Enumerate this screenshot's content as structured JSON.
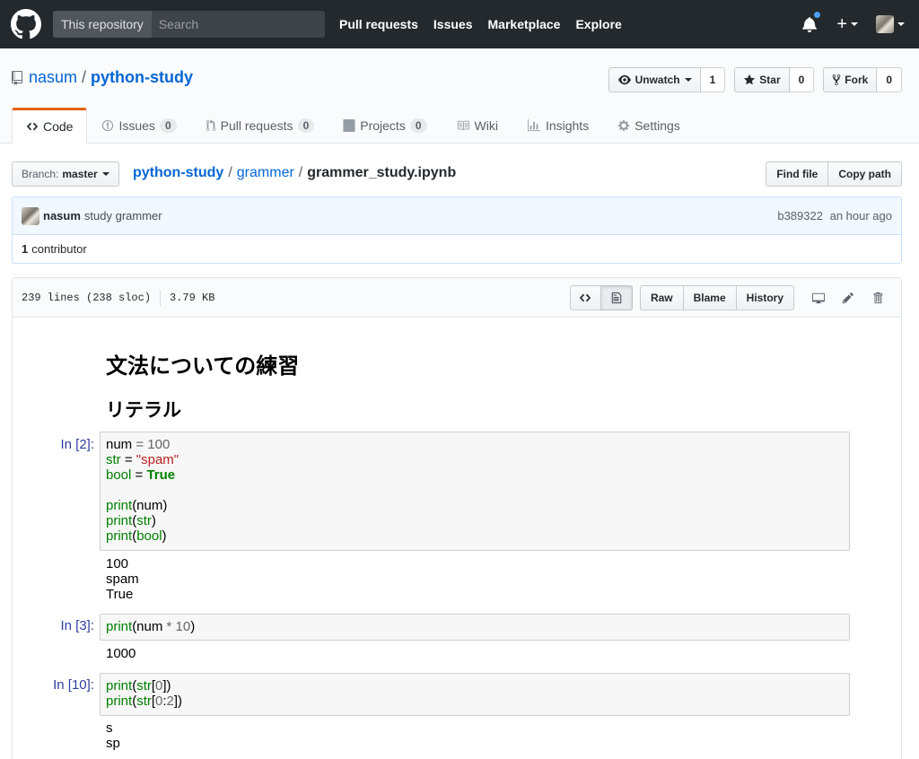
{
  "header": {
    "scope": "This repository",
    "search_placeholder": "Search",
    "nav": [
      "Pull requests",
      "Issues",
      "Marketplace",
      "Explore"
    ],
    "plus": "+"
  },
  "repo": {
    "owner": "nasum",
    "separator": "/",
    "name": "python-study",
    "watch_label": "Unwatch",
    "watch_count": "1",
    "star_label": "Star",
    "star_count": "0",
    "fork_label": "Fork",
    "fork_count": "0"
  },
  "tabs": [
    {
      "label": "Code",
      "icon": "code-icon"
    },
    {
      "label": "Issues",
      "count": "0",
      "icon": "issue-icon"
    },
    {
      "label": "Pull requests",
      "count": "0",
      "icon": "pull-request-icon"
    },
    {
      "label": "Projects",
      "count": "0",
      "icon": "project-icon"
    },
    {
      "label": "Wiki",
      "icon": "book-icon"
    },
    {
      "label": "Insights",
      "icon": "graph-icon"
    },
    {
      "label": "Settings",
      "icon": "gear-icon"
    }
  ],
  "file_nav": {
    "branch_label": "Branch:",
    "branch": "master",
    "crumbs": [
      "python-study",
      "grammer"
    ],
    "filename": "grammer_study.ipynb",
    "sep": "/",
    "find_file": "Find file",
    "copy_path": "Copy path"
  },
  "commit": {
    "author": "nasum",
    "message": "study grammer",
    "sha": "b389322",
    "time": "an hour ago",
    "contributors_count": "1",
    "contributors_label": "contributor"
  },
  "file": {
    "lines": "239 lines (238 sloc)",
    "size": "3.79 KB",
    "raw": "Raw",
    "blame": "Blame",
    "history": "History"
  },
  "notebook": {
    "h1": "文法についての練習",
    "h2": "リテラル",
    "cells": [
      {
        "prompt": "In [2]:",
        "code": [
          [
            [
              "num ",
              ""
            ],
            [
              "=",
              "n"
            ],
            [
              " ",
              ""
            ],
            [
              "100",
              "n"
            ]
          ],
          [
            [
              "str",
              "k"
            ],
            [
              " = ",
              ""
            ],
            [
              "\"spam\"",
              "s"
            ]
          ],
          [
            [
              "bool",
              "k"
            ],
            [
              " = ",
              ""
            ],
            [
              "True",
              "b"
            ]
          ],
          [],
          [
            [
              "print",
              "k"
            ],
            [
              "(num)",
              ""
            ]
          ],
          [
            [
              "print",
              "k"
            ],
            [
              "(",
              ""
            ],
            [
              "str",
              "k"
            ],
            [
              ")",
              ""
            ]
          ],
          [
            [
              "print",
              "k"
            ],
            [
              "(",
              ""
            ],
            [
              "bool",
              "k"
            ],
            [
              ")",
              ""
            ]
          ]
        ],
        "output": [
          "100",
          "spam",
          "True"
        ]
      },
      {
        "prompt": "In [3]:",
        "code": [
          [
            [
              "print",
              "k"
            ],
            [
              "(num ",
              ""
            ],
            [
              "*",
              "n"
            ],
            [
              " ",
              ""
            ],
            [
              "10",
              "n"
            ],
            [
              ")",
              ""
            ]
          ]
        ],
        "output": [
          "1000"
        ]
      },
      {
        "prompt": "In [10]:",
        "code": [
          [
            [
              "print",
              "k"
            ],
            [
              "(",
              ""
            ],
            [
              "str",
              "k"
            ],
            [
              "[",
              ""
            ],
            [
              "0",
              "n"
            ],
            [
              "])",
              ""
            ]
          ],
          [
            [
              "print",
              "k"
            ],
            [
              "(",
              ""
            ],
            [
              "str",
              "k"
            ],
            [
              "[",
              ""
            ],
            [
              "0",
              "n"
            ],
            [
              ":",
              ""
            ],
            [
              "2",
              "n"
            ],
            [
              "])",
              ""
            ]
          ]
        ],
        "output": [
          "s",
          "sp"
        ]
      }
    ]
  }
}
